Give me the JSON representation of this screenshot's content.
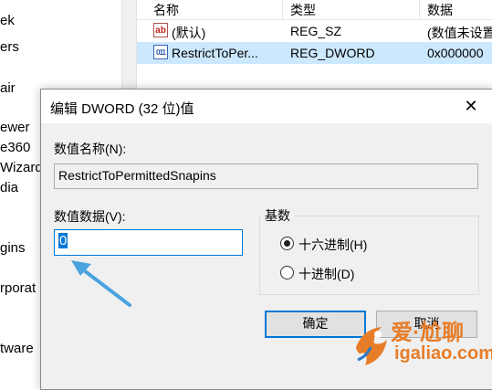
{
  "tree": {
    "items": [
      "ek",
      "ers",
      "air",
      "ewer",
      "e360",
      "Wizard",
      "dia",
      "gins",
      "rporat",
      "tware"
    ]
  },
  "list": {
    "headers": {
      "name": "名称",
      "type": "类型",
      "data": "数据"
    },
    "rows": [
      {
        "icon": "string-value-icon",
        "name": "(默认)",
        "type": "REG_SZ",
        "data": "(数值未设置"
      },
      {
        "icon": "binary-value-icon",
        "name": "RestrictToPer...",
        "type": "REG_DWORD",
        "data": "0x000000"
      }
    ]
  },
  "dialog": {
    "title": "编辑 DWORD (32 位)值",
    "close_glyph": "✕",
    "name_label": "数值名称(N):",
    "name_value": "RestrictToPermittedSnapins",
    "data_label": "数值数据(V):",
    "data_value": "0",
    "base_label": "基数",
    "radio_hex": "十六进制(H)",
    "radio_dec": "十进制(D)",
    "selected_base": "hex",
    "ok_label": "确定",
    "cancel_label": "取消"
  },
  "watermark": {
    "cn": "爱·尬聊",
    "en": "igaliao.com"
  },
  "colors": {
    "accent": "#0078d7",
    "arrow": "#4aa3df",
    "watermark": "#e87d28",
    "selection": "#cce8ff"
  }
}
